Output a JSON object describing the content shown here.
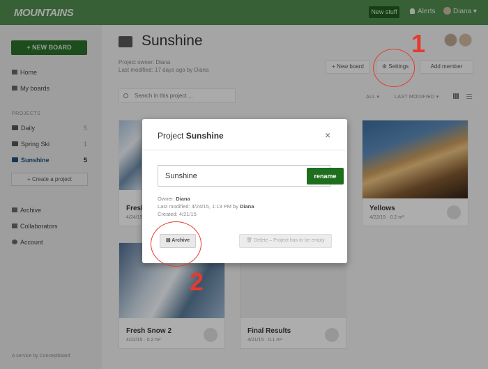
{
  "topbar": {
    "logo": "MOUNTAINS",
    "new_stuff": "New stuff",
    "alerts": "Alerts",
    "user": "Diana ▾"
  },
  "sidebar": {
    "new_board": "+ NEW BOARD",
    "nav": [
      {
        "label": "Home",
        "icon": "home-icon"
      },
      {
        "label": "My boards",
        "icon": "grid-icon"
      }
    ],
    "projects_heading": "PROJECTS",
    "projects": [
      {
        "label": "Daily",
        "count": "5"
      },
      {
        "label": "Spring Ski",
        "count": "1"
      },
      {
        "label": "Sunshine",
        "count": "5"
      }
    ],
    "create_project": "+ Create a project",
    "bottom_nav": [
      {
        "label": "Archive",
        "icon": "archive-icon"
      },
      {
        "label": "Collaborators",
        "icon": "people-icon"
      },
      {
        "label": "Account",
        "icon": "gear-icon"
      }
    ],
    "footer": "A service by  Conceptboard"
  },
  "header": {
    "title": "Sunshine",
    "owner": "Project owner: Diana",
    "modified": "Last modified: 17 days ago by Diana",
    "new_board": "+ New board",
    "settings": "⚙ Settings",
    "add_member": "Add member"
  },
  "toolbar": {
    "search_placeholder": "Search in this project ...",
    "filter_all": "ALL ▾",
    "sort": "LAST MODIFIED ▾"
  },
  "cards": [
    {
      "name": "Fresh",
      "date": "4/24/15"
    },
    {
      "name": "Yellows",
      "date": "4/22/15",
      "size": "0.2 m²"
    },
    {
      "name": "Fresh Snow 2",
      "date": "4/22/15",
      "size": "0.2 m²"
    },
    {
      "name": "Final Results",
      "date": "4/21/15",
      "size": "0.1 m²"
    }
  ],
  "modal": {
    "title_prefix": "Project ",
    "title_name": "Sunshine",
    "close": "×",
    "name_value": "Sunshine",
    "rename": "rename",
    "owner_label": "Owner: ",
    "owner": "Diana",
    "modified_label": "Last modified: 4/24/15, 1:13 PM by ",
    "modified_by": "Diana",
    "created": "Created: 4/21/15",
    "archive": "▤ Archive",
    "delete": "🗑 Delete – Project has to be empty"
  },
  "annotations": {
    "one": "1",
    "two": "2"
  },
  "colors": {
    "brand_green": "#4f8a4f",
    "button_green": "#1e6e1e",
    "annotation_red": "#e53a2e"
  }
}
